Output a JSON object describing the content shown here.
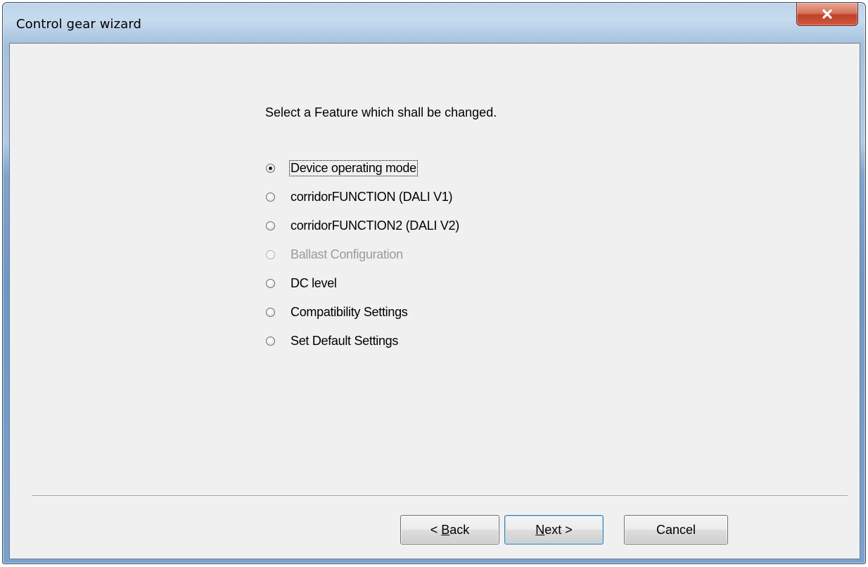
{
  "window": {
    "title": "Control gear wizard"
  },
  "prompt": "Select a Feature which shall be changed.",
  "options": [
    {
      "label": "Device operating mode",
      "checked": true,
      "disabled": false
    },
    {
      "label": "corridorFUNCTION (DALI V1)",
      "checked": false,
      "disabled": false
    },
    {
      "label": "corridorFUNCTION2 (DALI V2)",
      "checked": false,
      "disabled": false
    },
    {
      "label": "Ballast Configuration",
      "checked": false,
      "disabled": true
    },
    {
      "label": "DC level",
      "checked": false,
      "disabled": false
    },
    {
      "label": "Compatibility Settings",
      "checked": false,
      "disabled": false
    },
    {
      "label": "Set Default Settings",
      "checked": false,
      "disabled": false
    }
  ],
  "buttons": {
    "back": {
      "prefix": "< ",
      "mnemonic": "B",
      "rest": "ack"
    },
    "next": {
      "mnemonic": "N",
      "rest": "ext >"
    },
    "cancel": "Cancel"
  },
  "colors": {
    "client_bg": "#f0f0f0",
    "close_button": "#c0402a",
    "disabled_text": "#9b9b9b"
  },
  "icons": {
    "close": "close-icon"
  }
}
